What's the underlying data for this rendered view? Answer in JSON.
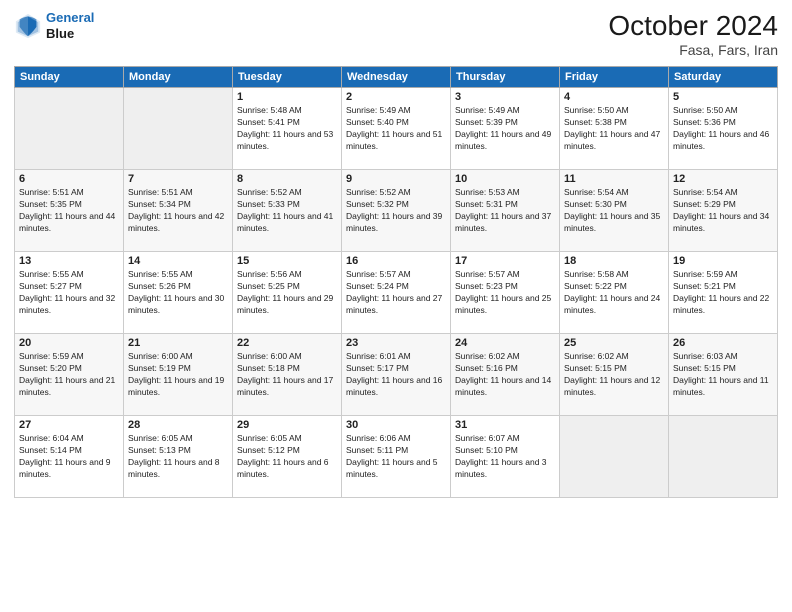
{
  "header": {
    "logo_line1": "General",
    "logo_line2": "Blue",
    "month": "October 2024",
    "location": "Fasa, Fars, Iran"
  },
  "days_of_week": [
    "Sunday",
    "Monday",
    "Tuesday",
    "Wednesday",
    "Thursday",
    "Friday",
    "Saturday"
  ],
  "weeks": [
    [
      {
        "day": "",
        "sunrise": "",
        "sunset": "",
        "daylight": ""
      },
      {
        "day": "",
        "sunrise": "",
        "sunset": "",
        "daylight": ""
      },
      {
        "day": "1",
        "sunrise": "Sunrise: 5:48 AM",
        "sunset": "Sunset: 5:41 PM",
        "daylight": "Daylight: 11 hours and 53 minutes."
      },
      {
        "day": "2",
        "sunrise": "Sunrise: 5:49 AM",
        "sunset": "Sunset: 5:40 PM",
        "daylight": "Daylight: 11 hours and 51 minutes."
      },
      {
        "day": "3",
        "sunrise": "Sunrise: 5:49 AM",
        "sunset": "Sunset: 5:39 PM",
        "daylight": "Daylight: 11 hours and 49 minutes."
      },
      {
        "day": "4",
        "sunrise": "Sunrise: 5:50 AM",
        "sunset": "Sunset: 5:38 PM",
        "daylight": "Daylight: 11 hours and 47 minutes."
      },
      {
        "day": "5",
        "sunrise": "Sunrise: 5:50 AM",
        "sunset": "Sunset: 5:36 PM",
        "daylight": "Daylight: 11 hours and 46 minutes."
      }
    ],
    [
      {
        "day": "6",
        "sunrise": "Sunrise: 5:51 AM",
        "sunset": "Sunset: 5:35 PM",
        "daylight": "Daylight: 11 hours and 44 minutes."
      },
      {
        "day": "7",
        "sunrise": "Sunrise: 5:51 AM",
        "sunset": "Sunset: 5:34 PM",
        "daylight": "Daylight: 11 hours and 42 minutes."
      },
      {
        "day": "8",
        "sunrise": "Sunrise: 5:52 AM",
        "sunset": "Sunset: 5:33 PM",
        "daylight": "Daylight: 11 hours and 41 minutes."
      },
      {
        "day": "9",
        "sunrise": "Sunrise: 5:52 AM",
        "sunset": "Sunset: 5:32 PM",
        "daylight": "Daylight: 11 hours and 39 minutes."
      },
      {
        "day": "10",
        "sunrise": "Sunrise: 5:53 AM",
        "sunset": "Sunset: 5:31 PM",
        "daylight": "Daylight: 11 hours and 37 minutes."
      },
      {
        "day": "11",
        "sunrise": "Sunrise: 5:54 AM",
        "sunset": "Sunset: 5:30 PM",
        "daylight": "Daylight: 11 hours and 35 minutes."
      },
      {
        "day": "12",
        "sunrise": "Sunrise: 5:54 AM",
        "sunset": "Sunset: 5:29 PM",
        "daylight": "Daylight: 11 hours and 34 minutes."
      }
    ],
    [
      {
        "day": "13",
        "sunrise": "Sunrise: 5:55 AM",
        "sunset": "Sunset: 5:27 PM",
        "daylight": "Daylight: 11 hours and 32 minutes."
      },
      {
        "day": "14",
        "sunrise": "Sunrise: 5:55 AM",
        "sunset": "Sunset: 5:26 PM",
        "daylight": "Daylight: 11 hours and 30 minutes."
      },
      {
        "day": "15",
        "sunrise": "Sunrise: 5:56 AM",
        "sunset": "Sunset: 5:25 PM",
        "daylight": "Daylight: 11 hours and 29 minutes."
      },
      {
        "day": "16",
        "sunrise": "Sunrise: 5:57 AM",
        "sunset": "Sunset: 5:24 PM",
        "daylight": "Daylight: 11 hours and 27 minutes."
      },
      {
        "day": "17",
        "sunrise": "Sunrise: 5:57 AM",
        "sunset": "Sunset: 5:23 PM",
        "daylight": "Daylight: 11 hours and 25 minutes."
      },
      {
        "day": "18",
        "sunrise": "Sunrise: 5:58 AM",
        "sunset": "Sunset: 5:22 PM",
        "daylight": "Daylight: 11 hours and 24 minutes."
      },
      {
        "day": "19",
        "sunrise": "Sunrise: 5:59 AM",
        "sunset": "Sunset: 5:21 PM",
        "daylight": "Daylight: 11 hours and 22 minutes."
      }
    ],
    [
      {
        "day": "20",
        "sunrise": "Sunrise: 5:59 AM",
        "sunset": "Sunset: 5:20 PM",
        "daylight": "Daylight: 11 hours and 21 minutes."
      },
      {
        "day": "21",
        "sunrise": "Sunrise: 6:00 AM",
        "sunset": "Sunset: 5:19 PM",
        "daylight": "Daylight: 11 hours and 19 minutes."
      },
      {
        "day": "22",
        "sunrise": "Sunrise: 6:00 AM",
        "sunset": "Sunset: 5:18 PM",
        "daylight": "Daylight: 11 hours and 17 minutes."
      },
      {
        "day": "23",
        "sunrise": "Sunrise: 6:01 AM",
        "sunset": "Sunset: 5:17 PM",
        "daylight": "Daylight: 11 hours and 16 minutes."
      },
      {
        "day": "24",
        "sunrise": "Sunrise: 6:02 AM",
        "sunset": "Sunset: 5:16 PM",
        "daylight": "Daylight: 11 hours and 14 minutes."
      },
      {
        "day": "25",
        "sunrise": "Sunrise: 6:02 AM",
        "sunset": "Sunset: 5:15 PM",
        "daylight": "Daylight: 11 hours and 12 minutes."
      },
      {
        "day": "26",
        "sunrise": "Sunrise: 6:03 AM",
        "sunset": "Sunset: 5:15 PM",
        "daylight": "Daylight: 11 hours and 11 minutes."
      }
    ],
    [
      {
        "day": "27",
        "sunrise": "Sunrise: 6:04 AM",
        "sunset": "Sunset: 5:14 PM",
        "daylight": "Daylight: 11 hours and 9 minutes."
      },
      {
        "day": "28",
        "sunrise": "Sunrise: 6:05 AM",
        "sunset": "Sunset: 5:13 PM",
        "daylight": "Daylight: 11 hours and 8 minutes."
      },
      {
        "day": "29",
        "sunrise": "Sunrise: 6:05 AM",
        "sunset": "Sunset: 5:12 PM",
        "daylight": "Daylight: 11 hours and 6 minutes."
      },
      {
        "day": "30",
        "sunrise": "Sunrise: 6:06 AM",
        "sunset": "Sunset: 5:11 PM",
        "daylight": "Daylight: 11 hours and 5 minutes."
      },
      {
        "day": "31",
        "sunrise": "Sunrise: 6:07 AM",
        "sunset": "Sunset: 5:10 PM",
        "daylight": "Daylight: 11 hours and 3 minutes."
      },
      {
        "day": "",
        "sunrise": "",
        "sunset": "",
        "daylight": ""
      },
      {
        "day": "",
        "sunrise": "",
        "sunset": "",
        "daylight": ""
      }
    ]
  ]
}
